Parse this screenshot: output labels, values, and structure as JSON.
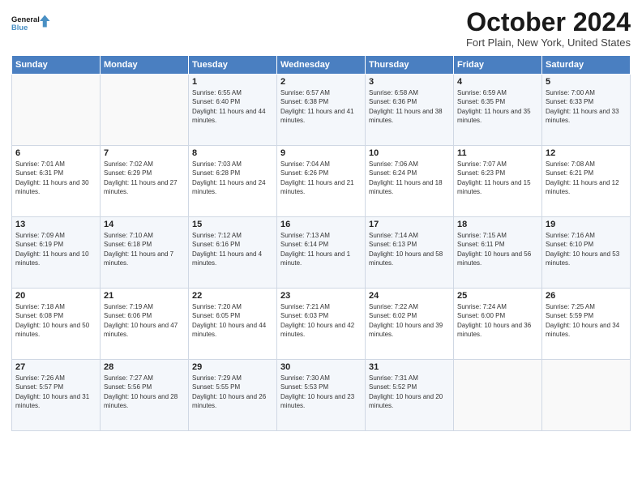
{
  "logo": {
    "line1": "General",
    "line2": "Blue"
  },
  "title": "October 2024",
  "location": "Fort Plain, New York, United States",
  "days_of_week": [
    "Sunday",
    "Monday",
    "Tuesday",
    "Wednesday",
    "Thursday",
    "Friday",
    "Saturday"
  ],
  "weeks": [
    [
      {
        "day": "",
        "content": ""
      },
      {
        "day": "",
        "content": ""
      },
      {
        "day": "1",
        "content": "Sunrise: 6:55 AM\nSunset: 6:40 PM\nDaylight: 11 hours and 44 minutes."
      },
      {
        "day": "2",
        "content": "Sunrise: 6:57 AM\nSunset: 6:38 PM\nDaylight: 11 hours and 41 minutes."
      },
      {
        "day": "3",
        "content": "Sunrise: 6:58 AM\nSunset: 6:36 PM\nDaylight: 11 hours and 38 minutes."
      },
      {
        "day": "4",
        "content": "Sunrise: 6:59 AM\nSunset: 6:35 PM\nDaylight: 11 hours and 35 minutes."
      },
      {
        "day": "5",
        "content": "Sunrise: 7:00 AM\nSunset: 6:33 PM\nDaylight: 11 hours and 33 minutes."
      }
    ],
    [
      {
        "day": "6",
        "content": "Sunrise: 7:01 AM\nSunset: 6:31 PM\nDaylight: 11 hours and 30 minutes."
      },
      {
        "day": "7",
        "content": "Sunrise: 7:02 AM\nSunset: 6:29 PM\nDaylight: 11 hours and 27 minutes."
      },
      {
        "day": "8",
        "content": "Sunrise: 7:03 AM\nSunset: 6:28 PM\nDaylight: 11 hours and 24 minutes."
      },
      {
        "day": "9",
        "content": "Sunrise: 7:04 AM\nSunset: 6:26 PM\nDaylight: 11 hours and 21 minutes."
      },
      {
        "day": "10",
        "content": "Sunrise: 7:06 AM\nSunset: 6:24 PM\nDaylight: 11 hours and 18 minutes."
      },
      {
        "day": "11",
        "content": "Sunrise: 7:07 AM\nSunset: 6:23 PM\nDaylight: 11 hours and 15 minutes."
      },
      {
        "day": "12",
        "content": "Sunrise: 7:08 AM\nSunset: 6:21 PM\nDaylight: 11 hours and 12 minutes."
      }
    ],
    [
      {
        "day": "13",
        "content": "Sunrise: 7:09 AM\nSunset: 6:19 PM\nDaylight: 11 hours and 10 minutes."
      },
      {
        "day": "14",
        "content": "Sunrise: 7:10 AM\nSunset: 6:18 PM\nDaylight: 11 hours and 7 minutes."
      },
      {
        "day": "15",
        "content": "Sunrise: 7:12 AM\nSunset: 6:16 PM\nDaylight: 11 hours and 4 minutes."
      },
      {
        "day": "16",
        "content": "Sunrise: 7:13 AM\nSunset: 6:14 PM\nDaylight: 11 hours and 1 minute."
      },
      {
        "day": "17",
        "content": "Sunrise: 7:14 AM\nSunset: 6:13 PM\nDaylight: 10 hours and 58 minutes."
      },
      {
        "day": "18",
        "content": "Sunrise: 7:15 AM\nSunset: 6:11 PM\nDaylight: 10 hours and 56 minutes."
      },
      {
        "day": "19",
        "content": "Sunrise: 7:16 AM\nSunset: 6:10 PM\nDaylight: 10 hours and 53 minutes."
      }
    ],
    [
      {
        "day": "20",
        "content": "Sunrise: 7:18 AM\nSunset: 6:08 PM\nDaylight: 10 hours and 50 minutes."
      },
      {
        "day": "21",
        "content": "Sunrise: 7:19 AM\nSunset: 6:06 PM\nDaylight: 10 hours and 47 minutes."
      },
      {
        "day": "22",
        "content": "Sunrise: 7:20 AM\nSunset: 6:05 PM\nDaylight: 10 hours and 44 minutes."
      },
      {
        "day": "23",
        "content": "Sunrise: 7:21 AM\nSunset: 6:03 PM\nDaylight: 10 hours and 42 minutes."
      },
      {
        "day": "24",
        "content": "Sunrise: 7:22 AM\nSunset: 6:02 PM\nDaylight: 10 hours and 39 minutes."
      },
      {
        "day": "25",
        "content": "Sunrise: 7:24 AM\nSunset: 6:00 PM\nDaylight: 10 hours and 36 minutes."
      },
      {
        "day": "26",
        "content": "Sunrise: 7:25 AM\nSunset: 5:59 PM\nDaylight: 10 hours and 34 minutes."
      }
    ],
    [
      {
        "day": "27",
        "content": "Sunrise: 7:26 AM\nSunset: 5:57 PM\nDaylight: 10 hours and 31 minutes."
      },
      {
        "day": "28",
        "content": "Sunrise: 7:27 AM\nSunset: 5:56 PM\nDaylight: 10 hours and 28 minutes."
      },
      {
        "day": "29",
        "content": "Sunrise: 7:29 AM\nSunset: 5:55 PM\nDaylight: 10 hours and 26 minutes."
      },
      {
        "day": "30",
        "content": "Sunrise: 7:30 AM\nSunset: 5:53 PM\nDaylight: 10 hours and 23 minutes."
      },
      {
        "day": "31",
        "content": "Sunrise: 7:31 AM\nSunset: 5:52 PM\nDaylight: 10 hours and 20 minutes."
      },
      {
        "day": "",
        "content": ""
      },
      {
        "day": "",
        "content": ""
      }
    ]
  ]
}
